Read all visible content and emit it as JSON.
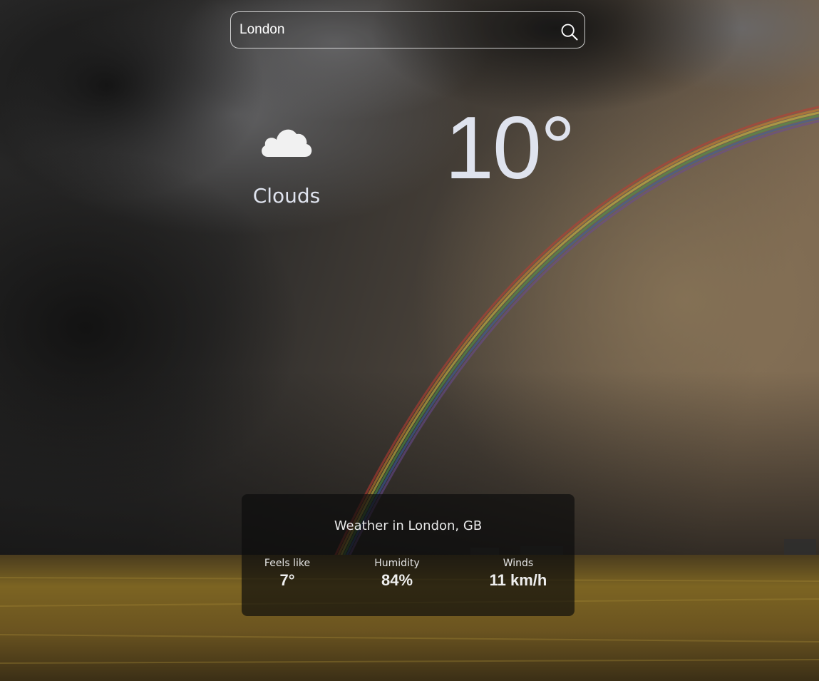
{
  "search": {
    "value": "London",
    "icon": "search-icon"
  },
  "current": {
    "icon": "cloud-icon",
    "condition": "Clouds",
    "temperature": "10°"
  },
  "details": {
    "title": "Weather in London, GB",
    "stats": [
      {
        "label": "Feels like",
        "value": "7°"
      },
      {
        "label": "Humidity",
        "value": "84%"
      },
      {
        "label": "Winds",
        "value": "11 km/h"
      }
    ]
  }
}
